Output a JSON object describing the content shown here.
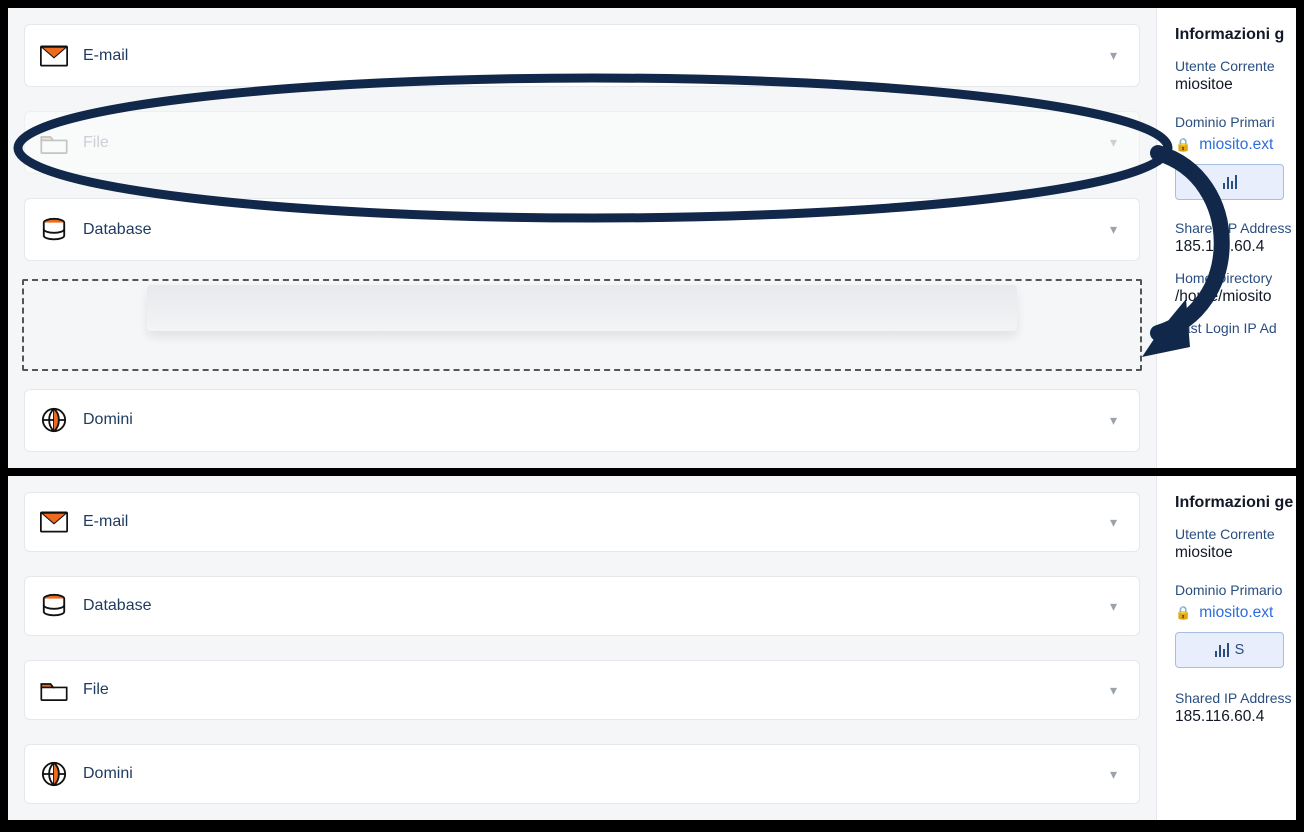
{
  "screens": {
    "top": {
      "cards": {
        "email": {
          "label": "E-mail"
        },
        "file": {
          "label": "File"
        },
        "database": {
          "label": "Database"
        },
        "domini": {
          "label": "Domini"
        }
      }
    },
    "bottom": {
      "cards": {
        "email": {
          "label": "E-mail"
        },
        "database": {
          "label": "Database"
        },
        "file": {
          "label": "File"
        },
        "domini": {
          "label": "Domini"
        }
      }
    }
  },
  "side": {
    "heading": "Informazioni ge",
    "current_user_label": "Utente Corrente",
    "current_user_value": "miositoe",
    "primary_domain_label": "Dominio Primario",
    "primary_domain_value": "miosito.ext",
    "shared_ip_label": "Shared IP Address",
    "shared_ip_value": "185.116.60.4",
    "home_dir_label": "Home Directory",
    "home_dir_value": "/home/miosito",
    "last_login_label": "Last Login IP Ad"
  },
  "side_top": {
    "heading": "Informazioni g",
    "primary_domain_label": "Dominio Primari"
  }
}
